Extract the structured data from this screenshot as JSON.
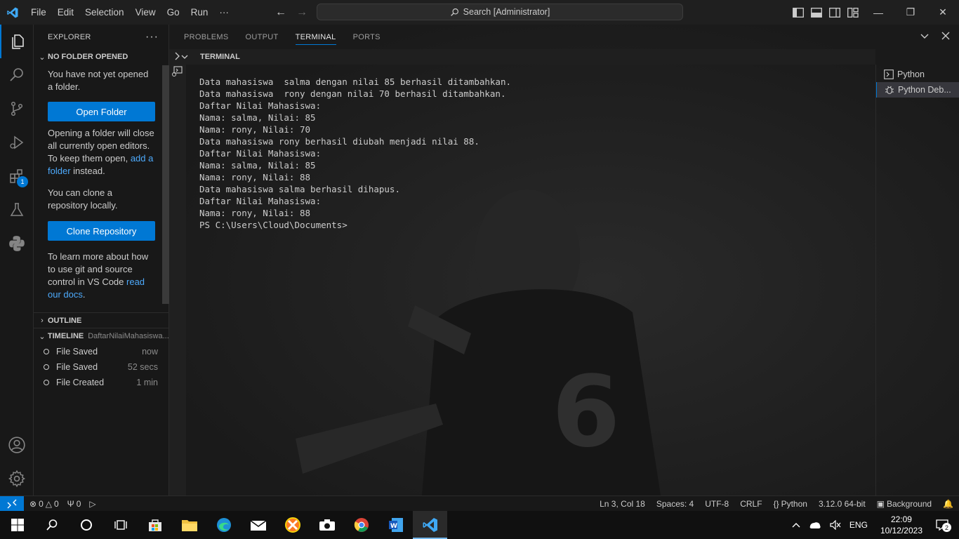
{
  "titlebar": {
    "menu": [
      "File",
      "Edit",
      "Selection",
      "View",
      "Go",
      "Run",
      "···"
    ],
    "search_text": "Search [Administrator]"
  },
  "explorer": {
    "header": "EXPLORER",
    "section_title": "NO FOLDER OPENED",
    "intro": "You have not yet opened a folder.",
    "open_folder_button": "Open Folder",
    "close_note_pre": "Opening a folder will close all currently open editors. To keep them open, ",
    "close_note_link": "add a folder",
    "close_note_post": " instead.",
    "clone_note": "You can clone a repository locally.",
    "clone_button": "Clone Repository",
    "learn_pre": "To learn more about how to use git and source control in VS Code ",
    "learn_link": "read our docs",
    "learn_post": ".",
    "outline_title": "OUTLINE",
    "timeline_title": "TIMELINE",
    "timeline_file": "DaftarNilaiMahasiswa...",
    "timeline": [
      {
        "label": "File Saved",
        "time": "now"
      },
      {
        "label": "File Saved",
        "time": "52 secs"
      },
      {
        "label": "File Created",
        "time": "1 min"
      }
    ]
  },
  "activity": {
    "extensions_badge": "1"
  },
  "panel": {
    "tabs": [
      "PROBLEMS",
      "OUTPUT",
      "TERMINAL",
      "PORTS"
    ],
    "active_tab": "TERMINAL",
    "section_title": "TERMINAL",
    "terminal_lines": [
      "Data mahasiswa  salma dengan nilai 85 berhasil ditambahkan.",
      "Data mahasiswa  rony dengan nilai 70 berhasil ditambahkan.",
      "Daftar Nilai Mahasiswa:",
      "Nama: salma, Nilai: 85",
      "Nama: rony, Nilai: 70",
      "Data mahasiswa rony berhasil diubah menjadi nilai 88.",
      "Daftar Nilai Mahasiswa:",
      "Nama: salma, Nilai: 85",
      "Nama: rony, Nilai: 88",
      "Data mahasiswa salma berhasil dihapus.",
      "Daftar Nilai Mahasiswa:",
      "Nama: rony, Nilai: 88",
      "PS C:\\Users\\Cloud\\Documents>"
    ],
    "terminal_list": [
      "Python",
      "Python Deb..."
    ]
  },
  "statusbar": {
    "errors": "0",
    "warnings": "0",
    "ports": "0",
    "position": "Ln 3, Col 18",
    "spaces": "Spaces: 4",
    "encoding": "UTF-8",
    "eol": "CRLF",
    "language": "Python",
    "interpreter": "3.12.0 64-bit",
    "background": "Background"
  },
  "taskbar": {
    "language": "ENG",
    "time": "22:09",
    "date": "10/12/2023",
    "notifications": "2"
  },
  "colors": {
    "accent": "#0078d4",
    "link": "#4daafc",
    "editor_bg": "#181818"
  }
}
